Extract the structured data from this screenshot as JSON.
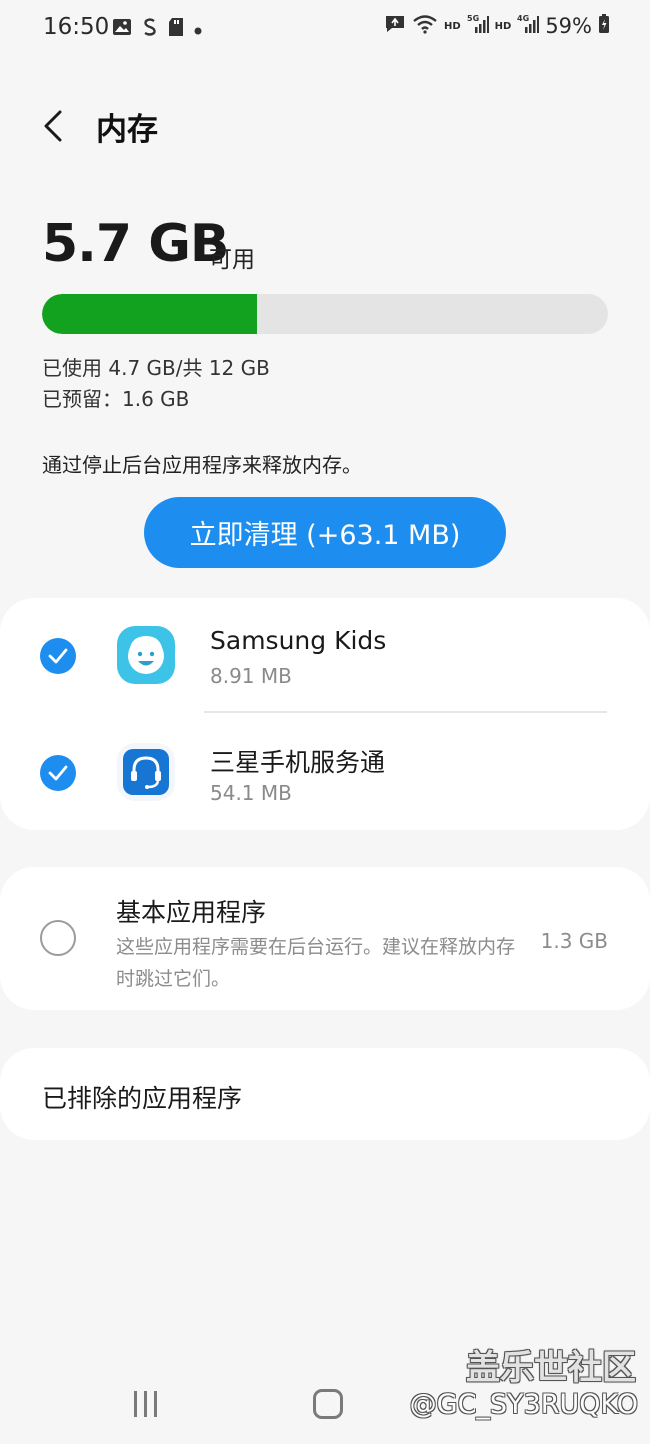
{
  "status_bar": {
    "time": "16:50",
    "battery": "59%",
    "network_1": "HD",
    "signal_1": "5G",
    "network_2": "HD",
    "signal_2": "4G",
    "icons": [
      "image-icon",
      "s-app-icon",
      "sd-card-icon",
      "dot-icon",
      "message-icon",
      "wifi-icon",
      "signal-icon",
      "battery-icon"
    ]
  },
  "header": {
    "title": "内存",
    "back_icon": "chevron-left-icon"
  },
  "memory": {
    "available": "5.7 GB",
    "available_unit": "可用",
    "used_fraction": 0.38,
    "used_text": "已使用 4.7 GB/共 12 GB",
    "reserved_text": "已预留：1.6 GB",
    "bar_color": "#13a21f"
  },
  "hint": "通过停止后台应用程序来释放内存。",
  "clean_button": {
    "label": "立即清理 (+63.1 MB)",
    "color": "#1d8ef0"
  },
  "apps": [
    {
      "name": "Samsung Kids",
      "size": "8.91 MB",
      "checked": true,
      "icon": "samsung-kids-icon"
    },
    {
      "name": "三星手机服务通",
      "size": "54.1 MB",
      "checked": true,
      "icon": "headset-icon"
    }
  ],
  "basic_apps": {
    "title": "基本应用程序",
    "description": "这些应用程序需要在后台运行。建议在释放内存时跳过它们。",
    "size": "1.3 GB",
    "checked": false
  },
  "excluded": {
    "label": "已排除的应用程序"
  },
  "watermark": {
    "line1": "盖乐世社区",
    "line2": "@GC_SY3RUQKO"
  },
  "nav": {
    "recent_icon": "recent-apps-icon",
    "home_icon": "home-icon",
    "back_icon": "back-icon"
  }
}
